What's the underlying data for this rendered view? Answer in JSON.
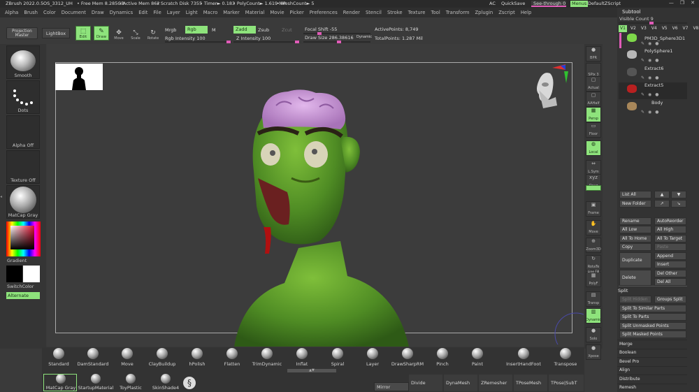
{
  "titlebar": {
    "app": "ZBrush 2022.0.5",
    "file": "OS_3312_UH",
    "free_mem": "• Free Mem 8.285GB",
    "active_mem": "• Active Mem 862",
    "scratch": "• Scratch Disk 7355",
    "timer": "• Timer► 0.183",
    "polycount": "• PolyCount► 1.619 MP",
    "meshcount": "• MeshCount► 5",
    "ac": "AC",
    "quicksave": "QuickSave",
    "see_through": "See-through  0",
    "menus": "Menus",
    "script": "DefaultZScript"
  },
  "menu": [
    "Alpha",
    "Brush",
    "Color",
    "Document",
    "Draw",
    "Dynamics",
    "Edit",
    "File",
    "Layer",
    "Light",
    "Macro",
    "Marker",
    "Material",
    "Movie",
    "Picker",
    "Preferences",
    "Render",
    "Stencil",
    "Stroke",
    "Texture",
    "Tool",
    "Transform",
    "Zplugin",
    "Zscript",
    "Help"
  ],
  "toolbar": {
    "projection_master": "Projection Master",
    "lightbox": "LightBox",
    "edit": "Edit",
    "draw": "Draw",
    "move": "Move",
    "scale": "Scale",
    "rotate": "Rotate",
    "mrgb": "Mrgb",
    "rgb": "Rgb",
    "m": "M",
    "rgb_intensity": "Rgb Intensity 100",
    "zadd": "Zadd",
    "zsub": "Zsub",
    "zcut": "Zcut",
    "z_intensity": "Z Intensity 100",
    "focal_shift": "Focal Shift -55",
    "draw_size": "Draw Size 286.38616",
    "dynamic": "Dynamic",
    "active_points": "ActivePoints: 8,749",
    "total_points": "TotalPoints: 1.287 Mil"
  },
  "left_shelf": {
    "brush": "Smooth",
    "stroke": "Dots",
    "alpha": "Alpha Off",
    "texture": "Texture Off",
    "material": "MatCap Gray",
    "gradient": "Gradient",
    "switch_color": "SwitchColor",
    "alternate": "Alternate"
  },
  "right_shelf": [
    "BPR",
    "SPix 3",
    "Actual",
    "AAHalf",
    "Persp",
    "Floor",
    "Local",
    "L.Sym",
    "Qxyz",
    "",
    "Frame",
    "Move",
    "Zoom3D",
    "RotaTe",
    "Line Fill PolyF",
    "Transp",
    "Solo",
    "Xpose"
  ],
  "right_shelf_labels": {
    "bpr": "BPR",
    "spix": "SPix 3",
    "actual": "Actual",
    "aahalf": "AAHalf",
    "persp": "Persp",
    "floor": "Floor",
    "local": "Local",
    "lsym": "L.Sym",
    "xyz": "Qxyz",
    "frame": "Frame",
    "move": "Move",
    "zoom": "Zoom3D",
    "rotate": "RotaTe",
    "polyf_top": "Line Fill",
    "polyf": "PolyF",
    "transp": "Transp",
    "dynamic": "Dynamic",
    "solo": "Solo",
    "xpose": "Xpose"
  },
  "brushes": [
    "Standard",
    "DamStandard",
    "Move",
    "ClayBuildup",
    "hPolish",
    "Flatten",
    "TrimDynamic",
    "Inflat",
    "Spiral",
    "Layer",
    "DrawSharpRM",
    "Pinch",
    "Paint",
    "InsertHandFoot",
    "Transpose"
  ],
  "materials": [
    "MatCap Gray",
    "StartupMaterial",
    "ToyPlastic",
    "SkinShade4"
  ],
  "bottom_actions": {
    "mirror": "Mirror",
    "divide": "Divide",
    "dynamesh": "DynaMesh",
    "zremesher": "ZRemesher",
    "tposemesh": "TPoseMesh",
    "tpose_subt": "TPose|SubT"
  },
  "subtool": {
    "title": "Subtool",
    "visible_count": "Visible Count 9",
    "versions": [
      "V1",
      "V2",
      "V3",
      "V4",
      "V5",
      "V6",
      "V7",
      "V8"
    ],
    "items": [
      "PM3D_Sphere3D1",
      "PolySphere1",
      "Extract6",
      "Extract5",
      "Body"
    ]
  },
  "subtool_buttons": {
    "list_all": "List All",
    "new_folder": "New Folder",
    "rename": "Rename",
    "auto_reorder": "AutoReorder",
    "all_low": "All Low",
    "all_high": "All High",
    "all_to_home": "All To Home",
    "all_to_target": "All To Target",
    "copy": "Copy",
    "paste": "Paste",
    "duplicate": "Duplicate",
    "append": "Append",
    "insert": "Insert",
    "delete": "Delete",
    "del_other": "Del Other",
    "del_all": "Del All"
  },
  "split": {
    "title": "Split",
    "split_hidden": "Split Hidden",
    "groups_split": "Groups Split",
    "similar": "Split To Similar Parts",
    "to_parts": "Split To Parts",
    "unmasked": "Split Unmasked Points",
    "masked": "Split Masked Points"
  },
  "subpalettes": [
    "Merge",
    "Boolean",
    "Bevel Pro",
    "Align",
    "Distribute",
    "Remesh"
  ],
  "colors": {
    "accent_green": "#8ee37c",
    "slider_pink": "#e05bb8",
    "canvas": "#3c3c3c"
  }
}
